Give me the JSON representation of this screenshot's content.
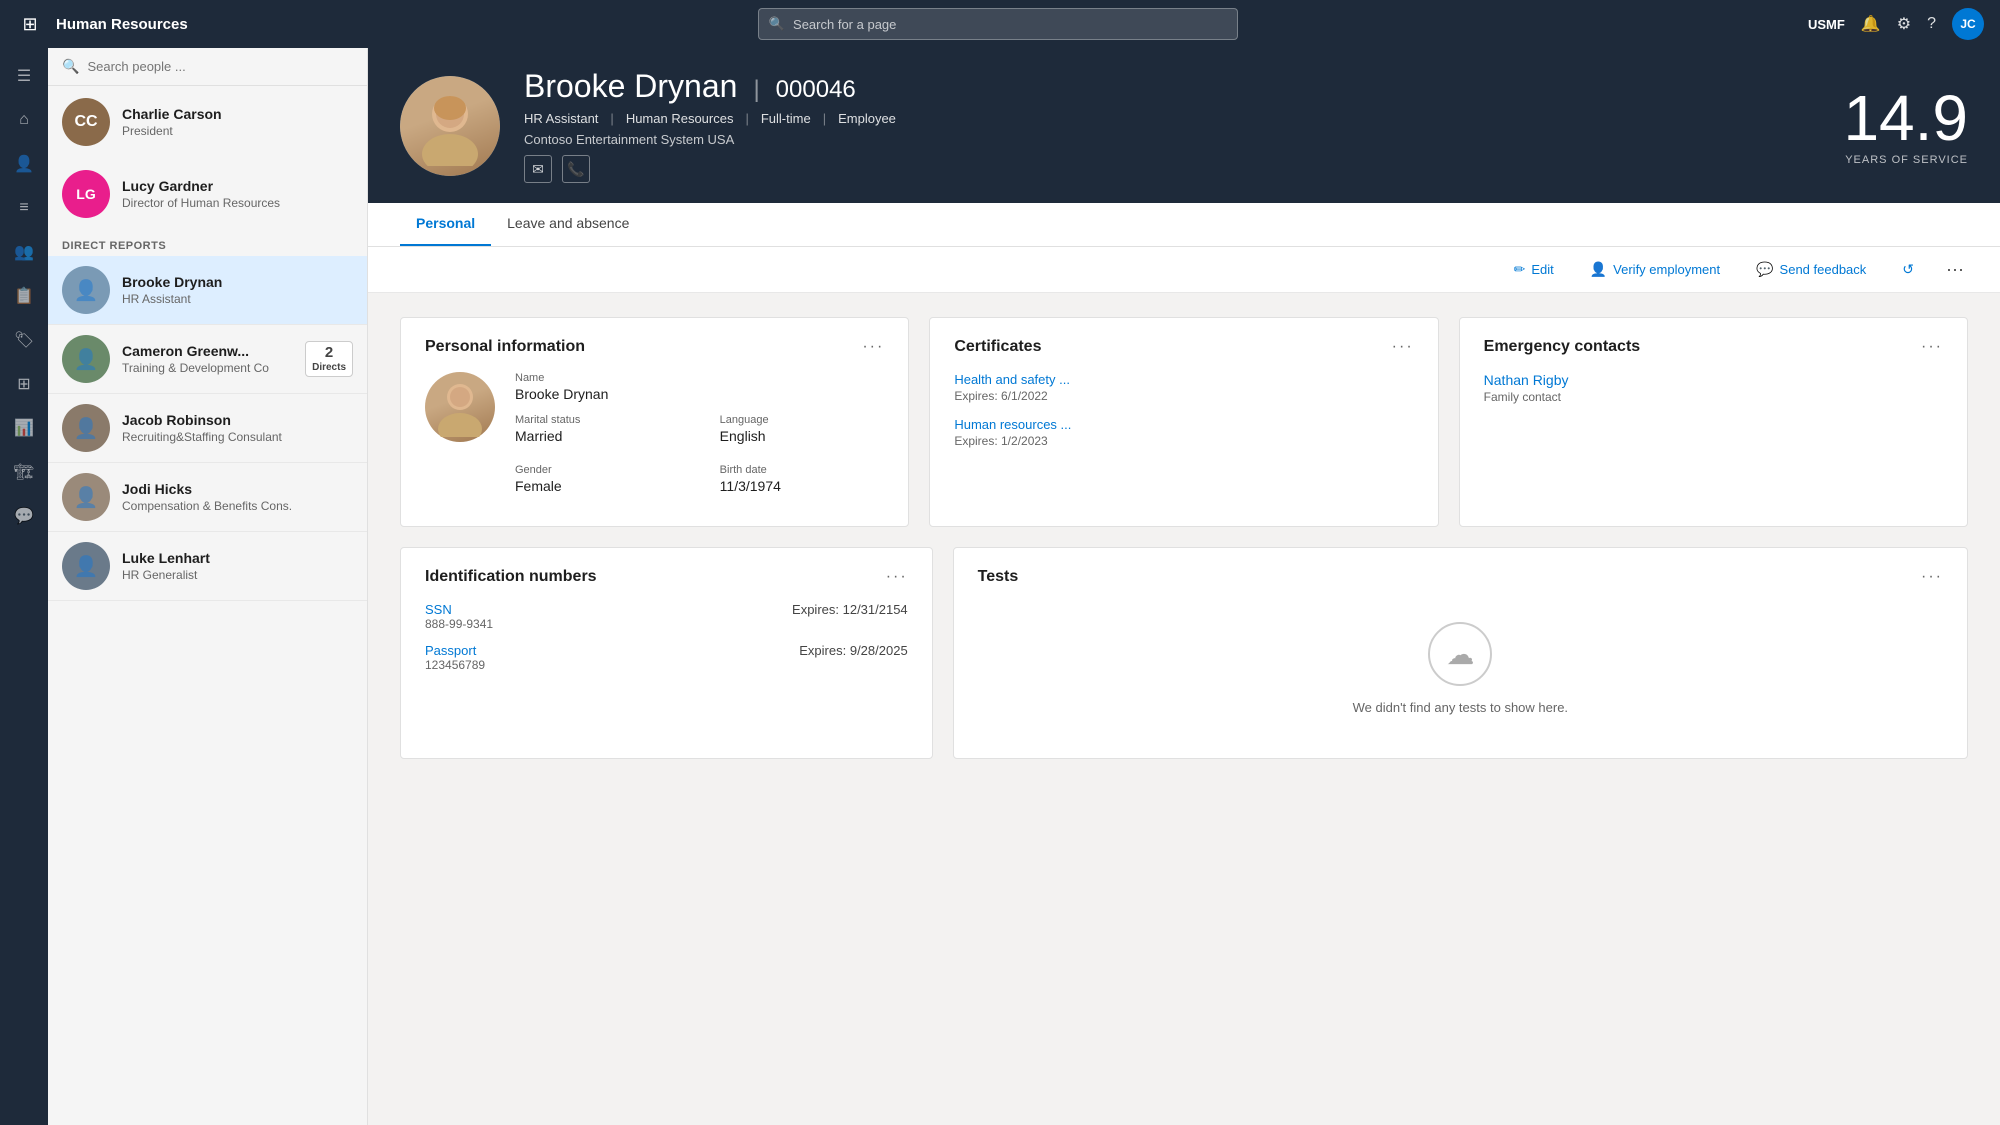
{
  "topnav": {
    "waffle_icon": "⊞",
    "title": "Human Resources",
    "search_placeholder": "Search for a page",
    "org_name": "USMF",
    "avatar_initials": "JC"
  },
  "sidebar": {
    "search_placeholder": "Search people ...",
    "manager": {
      "name": "Charlie Carson",
      "role": "President",
      "avatar_color": "#8a6a4a",
      "initials": "CC"
    },
    "manager2": {
      "name": "Lucy Gardner",
      "role": "Director of Human Resources",
      "avatar_color": "#e91e8c",
      "initials": "LG"
    },
    "section_label": "DIRECT REPORTS",
    "directs": [
      {
        "name": "Brooke Drynan",
        "role": "HR Assistant",
        "directs_count": null,
        "active": true
      },
      {
        "name": "Cameron Greenw...",
        "role": "Training & Development Co",
        "directs_count": "2",
        "directs_label": "Directs"
      },
      {
        "name": "Jacob Robinson",
        "role": "Recruiting&Staffing Consulant",
        "directs_count": null
      },
      {
        "name": "Jodi Hicks",
        "role": "Compensation & Benefits Cons.",
        "directs_count": null
      },
      {
        "name": "Luke Lenhart",
        "role": "HR Generalist",
        "directs_count": null
      }
    ]
  },
  "profile": {
    "name": "Brooke Drynan",
    "id": "000046",
    "job_title": "HR Assistant",
    "department": "Human Resources",
    "employment_type": "Full-time",
    "employee_type": "Employee",
    "company": "Contoso Entertainment System USA",
    "years_of_service": "14.9",
    "years_label": "YEARS OF SERVICE"
  },
  "tabs": [
    {
      "label": "Personal",
      "active": true
    },
    {
      "label": "Leave and absence",
      "active": false
    }
  ],
  "actions": {
    "edit_label": "Edit",
    "verify_label": "Verify employment",
    "feedback_label": "Send feedback"
  },
  "personal_info_card": {
    "title": "Personal information",
    "fields": {
      "name_label": "Name",
      "name_value": "Brooke Drynan",
      "marital_label": "Marital status",
      "marital_value": "Married",
      "language_label": "Language",
      "language_value": "English",
      "gender_label": "Gender",
      "gender_value": "Female",
      "birth_label": "Birth date",
      "birth_value": "11/3/1974"
    }
  },
  "certificates_card": {
    "title": "Certificates",
    "items": [
      {
        "name": "Health and safety ...",
        "expires": "Expires: 6/1/2022"
      },
      {
        "name": "Human resources ...",
        "expires": "Expires: 1/2/2023"
      }
    ]
  },
  "emergency_contacts_card": {
    "title": "Emergency contacts",
    "contacts": [
      {
        "name": "Nathan Rigby",
        "role": "Family contact"
      }
    ]
  },
  "identification_card": {
    "title": "Identification numbers",
    "items": [
      {
        "label": "SSN",
        "number": "888-99-9341",
        "expires": "Expires: 12/31/2154"
      },
      {
        "label": "Passport",
        "number": "123456789",
        "expires": "Expires: 9/28/2025"
      }
    ]
  },
  "tests_card": {
    "title": "Tests",
    "empty_text": "We didn't find any tests to show here."
  },
  "icon_nav": [
    {
      "icon": "☰",
      "name": "menu-icon"
    },
    {
      "icon": "⌂",
      "name": "home-icon"
    },
    {
      "icon": "👤",
      "name": "person-icon"
    },
    {
      "icon": "📋",
      "name": "list-icon"
    },
    {
      "icon": "👥",
      "name": "people-icon"
    },
    {
      "icon": "📄",
      "name": "document-icon"
    },
    {
      "icon": "🔖",
      "name": "bookmark-icon"
    },
    {
      "icon": "📊",
      "name": "chart-icon"
    },
    {
      "icon": "⚙",
      "name": "gear-icon"
    },
    {
      "icon": "🏗",
      "name": "org-icon"
    },
    {
      "icon": "💬",
      "name": "chat-icon"
    }
  ]
}
